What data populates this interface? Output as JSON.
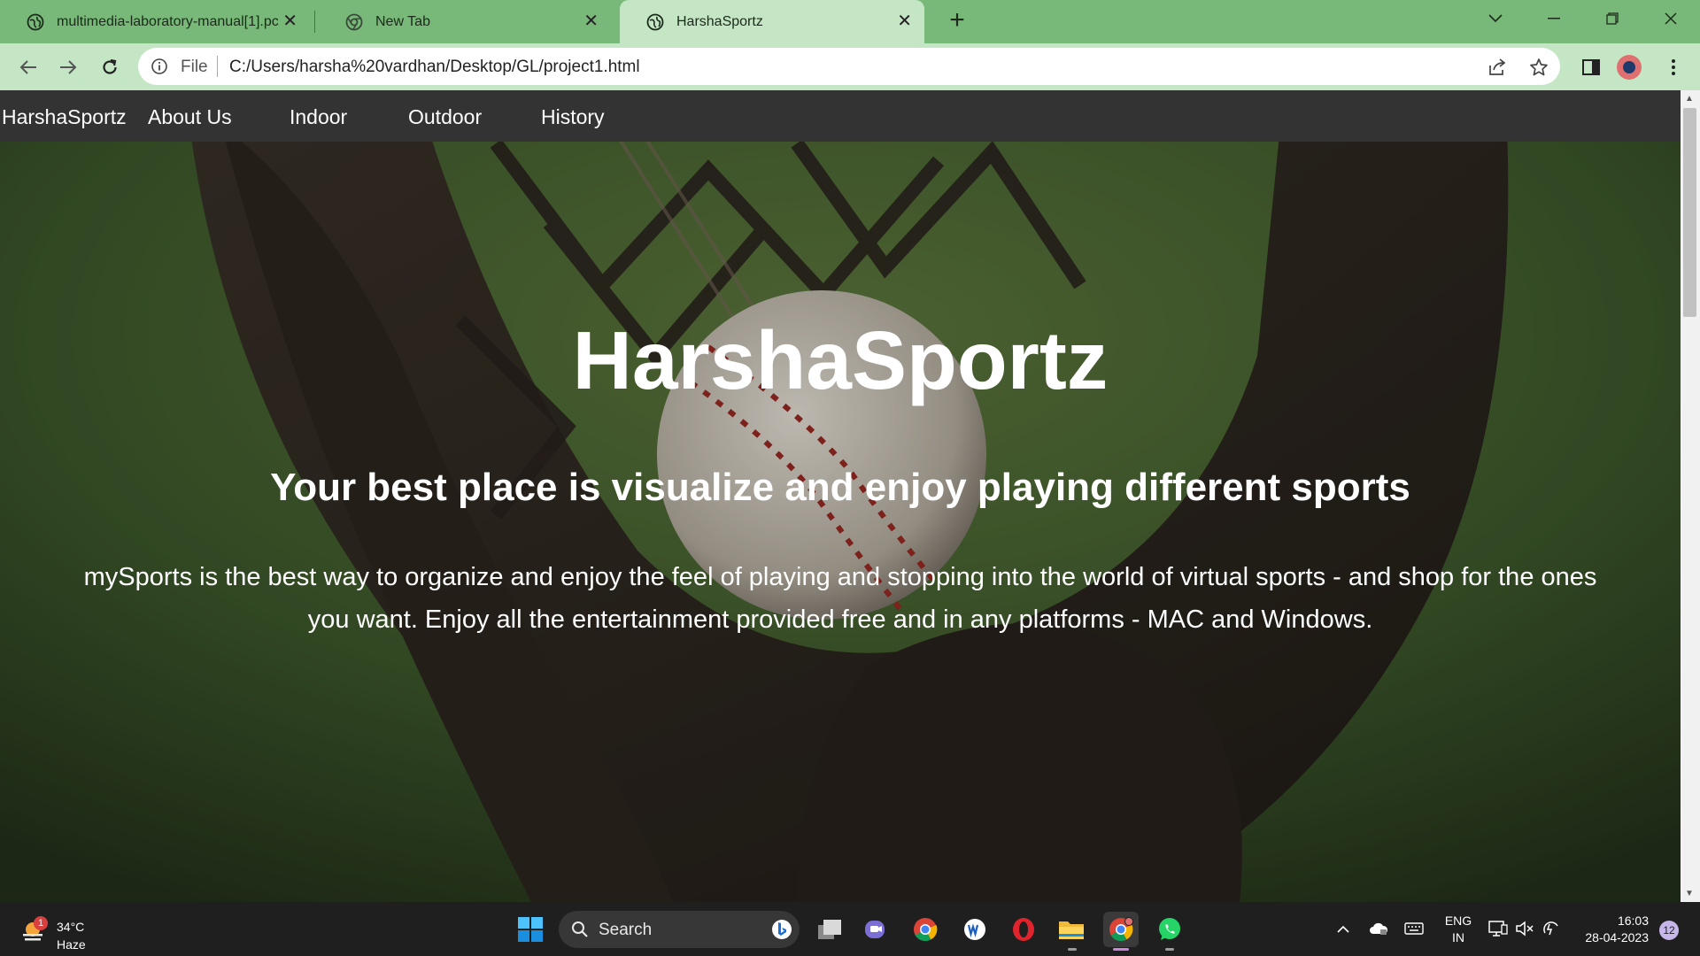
{
  "browser": {
    "tabs": [
      {
        "title": "multimedia-laboratory-manual[1].pc",
        "active": false
      },
      {
        "title": "New Tab",
        "active": false
      },
      {
        "title": "HarshaSportz",
        "active": true
      }
    ],
    "omnibox": {
      "scheme": "File",
      "url": "C:/Users/harsha%20vardhan/Desktop/GL/project1.html"
    }
  },
  "site": {
    "nav": {
      "brand": "HarshaSportz",
      "items": [
        "About Us",
        "Indoor",
        "Outdoor",
        "History"
      ]
    },
    "hero": {
      "title": "HarshaSportz",
      "subtitle": "Your best place is visualize and enjoy playing different sports",
      "text": "mySports is the best way to organize and enjoy the feel of playing and stopping into the world of virtual sports - and shop for the ones you want. Enjoy all the entertainment provided free and in any platforms - MAC and Windows."
    }
  },
  "taskbar": {
    "weather": {
      "temp": "34°C",
      "condition": "Haze",
      "badge": "1"
    },
    "search_label": "Search",
    "language": {
      "lang": "ENG",
      "region": "IN"
    },
    "clock": {
      "time": "16:03",
      "date": "28-04-2023"
    },
    "notifications": "12"
  },
  "colors": {
    "tab_strip": "#78b878",
    "active_tab": "#c4e6c4",
    "site_nav": "#333333",
    "taskbar": "#1f1f1f"
  }
}
